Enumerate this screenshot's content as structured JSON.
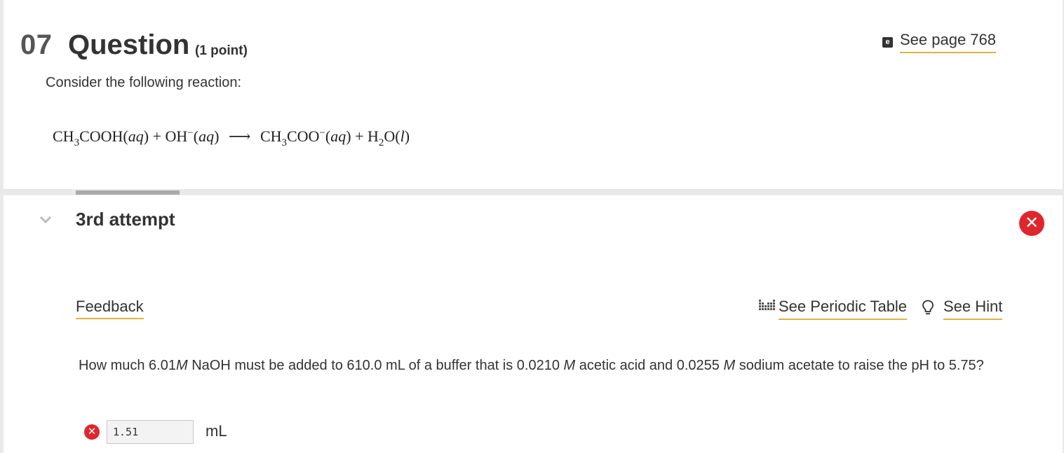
{
  "question": {
    "number": "07",
    "title": "Question",
    "points": "(1 point)",
    "see_page": "See page 768",
    "prompt": "Consider the following reaction:",
    "equation": {
      "r1_a": "CH",
      "r1_sub": "3",
      "r1_b": "COOH",
      "r1_state": "aq",
      "r2_a": "OH",
      "r2_sup": "−",
      "r2_state": "aq",
      "p1_a": "CH",
      "p1_sub": "3",
      "p1_b": "COO",
      "p1_sup": "−",
      "p1_state": "aq",
      "p2_a": "H",
      "p2_sub": "2",
      "p2_b": "O",
      "p2_state": "l"
    }
  },
  "attempt": {
    "label": "3rd attempt",
    "status_icon": "error-x-icon",
    "status_color": "#e0262d"
  },
  "links": {
    "feedback": "Feedback",
    "periodic_table": "See Periodic Table",
    "hint": "See Hint"
  },
  "body": {
    "t1": "How much 6.01",
    "m1": "M",
    "t2": " NaOH must be added to 610.0 mL of a buffer that is 0.0210 ",
    "m2": "M",
    "t3": " acetic acid and 0.0255 ",
    "m3": "M",
    "t4": " sodium acetate to raise the pH to 5.75?"
  },
  "answer": {
    "value": "1.51",
    "unit": "mL",
    "status_icon": "error-x-icon"
  },
  "colors": {
    "link_underline": "#e2b33f",
    "error_red": "#e0262d"
  }
}
